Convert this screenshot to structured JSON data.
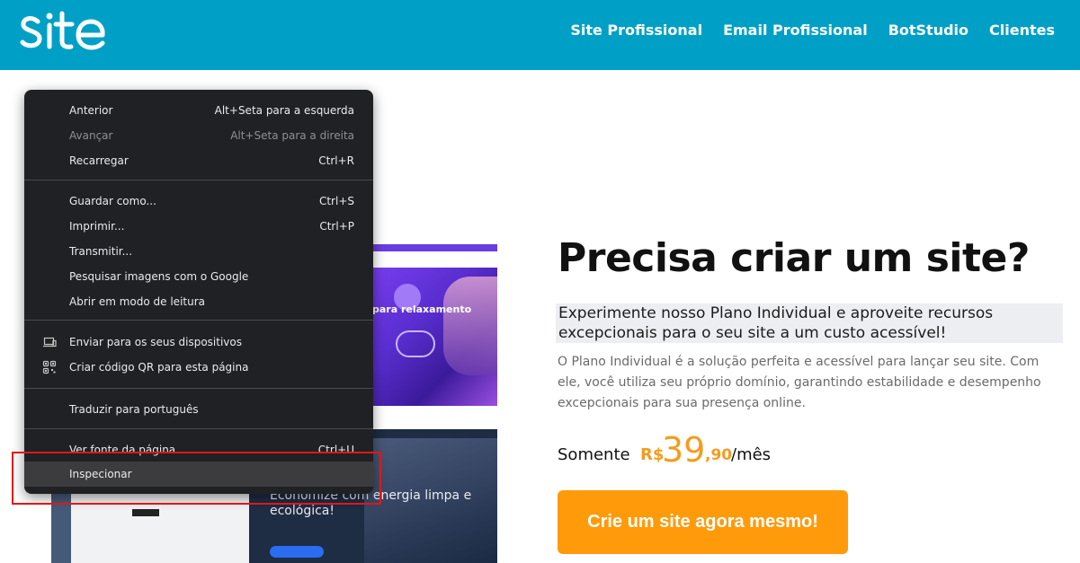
{
  "header": {
    "logo_text": "site",
    "nav": [
      "Site Profissional",
      "Email Profissional",
      "BotStudio",
      "Clientes"
    ]
  },
  "mockups": {
    "hero1_text": "para relaxamento",
    "hero2_text": "Economize com energia limpa e ecológica!"
  },
  "context_menu": {
    "items": [
      {
        "label": "Anterior",
        "shortcut": "Alt+Seta para a esquerda"
      },
      {
        "label": "Avançar",
        "shortcut": "Alt+Seta para a direita"
      },
      {
        "label": "Recarregar",
        "shortcut": "Ctrl+R"
      },
      {
        "label": "Guardar como...",
        "shortcut": "Ctrl+S"
      },
      {
        "label": "Imprimir...",
        "shortcut": "Ctrl+P"
      },
      {
        "label": "Transmitir..."
      },
      {
        "label": "Pesquisar imagens com o Google"
      },
      {
        "label": "Abrir em modo de leitura"
      },
      {
        "label": "Enviar para os seus dispositivos",
        "icon": "devices-icon"
      },
      {
        "label": "Criar código QR para esta página",
        "icon": "qr-code-icon"
      },
      {
        "label": "Traduzir para português"
      },
      {
        "label": "Ver fonte da página",
        "shortcut": "Ctrl+U"
      },
      {
        "label": "Inspecionar"
      }
    ]
  },
  "main": {
    "title": "Precisa criar um site?",
    "subtitle": "Experimente nosso Plano Individual e aproveite recursos excepcionais para o seu site a um custo acessível!",
    "description": "O Plano Individual é a solução perfeita e acessível para lançar seu site. Com ele, você utiliza seu próprio domínio, garantindo estabilidade e desempenho excepcionais para sua presença online.",
    "price": {
      "label": "Somente",
      "currency": "R$",
      "integer": "39",
      "decimal": ",90",
      "period": "/mês"
    },
    "cta": "Crie um site agora mesmo!"
  },
  "colors": {
    "header_bg": "#00a0c6",
    "accent_orange": "#ff9a0a",
    "menu_bg": "#202124",
    "highlight_red": "#e01818"
  }
}
